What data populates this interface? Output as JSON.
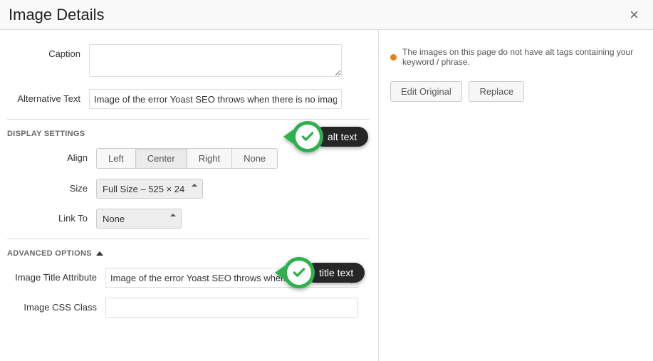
{
  "header": {
    "title": "Image Details"
  },
  "form": {
    "caption_label": "Caption",
    "caption_value": "",
    "alt_label": "Alternative Text",
    "alt_value": "Image of the error Yoast SEO throws when there is no image "
  },
  "display": {
    "section_title": "DISPLAY SETTINGS",
    "align_label": "Align",
    "align_options": {
      "left": "Left",
      "center": "Center",
      "right": "Right",
      "none": "None"
    },
    "size_label": "Size",
    "size_value": "Full Size – 525 × 24",
    "linkto_label": "Link To",
    "linkto_value": "None"
  },
  "advanced": {
    "section_title": "ADVANCED OPTIONS",
    "title_attr_label": "Image Title Attribute",
    "title_attr_value": "Image of the error Yoast SEO throws when there is no image ",
    "css_class_label": "Image CSS Class",
    "css_class_value": ""
  },
  "right": {
    "notice": "The images on this page do not have alt tags containing your keyword / phrase.",
    "edit_original": "Edit Original",
    "replace": "Replace"
  },
  "callouts": {
    "alt": "alt text",
    "title": "title text"
  }
}
